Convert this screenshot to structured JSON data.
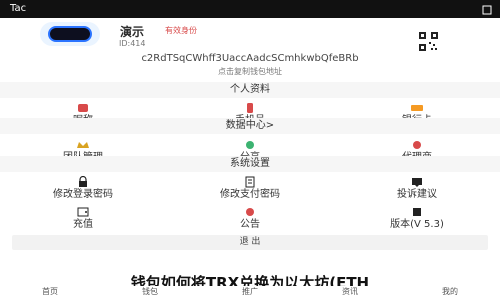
{
  "status": {
    "time": "Tac"
  },
  "profile": {
    "name": "演示",
    "badge": "有效身份",
    "id_text": "ID:414"
  },
  "address": {
    "value": "c2RdTSqCWhff3UaccAadcSCmhkwbQfeBRb",
    "hint": "点击复制钱包地址"
  },
  "sections": {
    "personal": "个人资料",
    "data": "数据中心>",
    "system": "系统设置"
  },
  "personal_items": [
    {
      "label": "昵称"
    },
    {
      "label": "手机号"
    },
    {
      "label": "银行卡"
    }
  ],
  "data_items": [
    {
      "label": "团队管理"
    },
    {
      "label": "分享"
    },
    {
      "label": "代理商"
    }
  ],
  "system_items_row1": [
    {
      "label": "修改登录密码"
    },
    {
      "label": "修改支付密码"
    },
    {
      "label": "投诉建议"
    }
  ],
  "system_items_row2": [
    {
      "label": "充值"
    },
    {
      "label": "公告"
    },
    {
      "label": "版本(V 5.3)"
    }
  ],
  "logout_label": "退 出",
  "banner_text": "钱包如何将TRX兑换为以太坊(ETH",
  "bottom_nav": [
    {
      "label": "首页"
    },
    {
      "label": "钱包"
    },
    {
      "label": "推广"
    },
    {
      "label": "资讯"
    },
    {
      "label": "我的"
    }
  ],
  "colors": {
    "accent": "#2b74ff",
    "red": "#d84a4a",
    "orange": "#f59a23",
    "gold": "#d9a321",
    "green": "#3cb371"
  }
}
